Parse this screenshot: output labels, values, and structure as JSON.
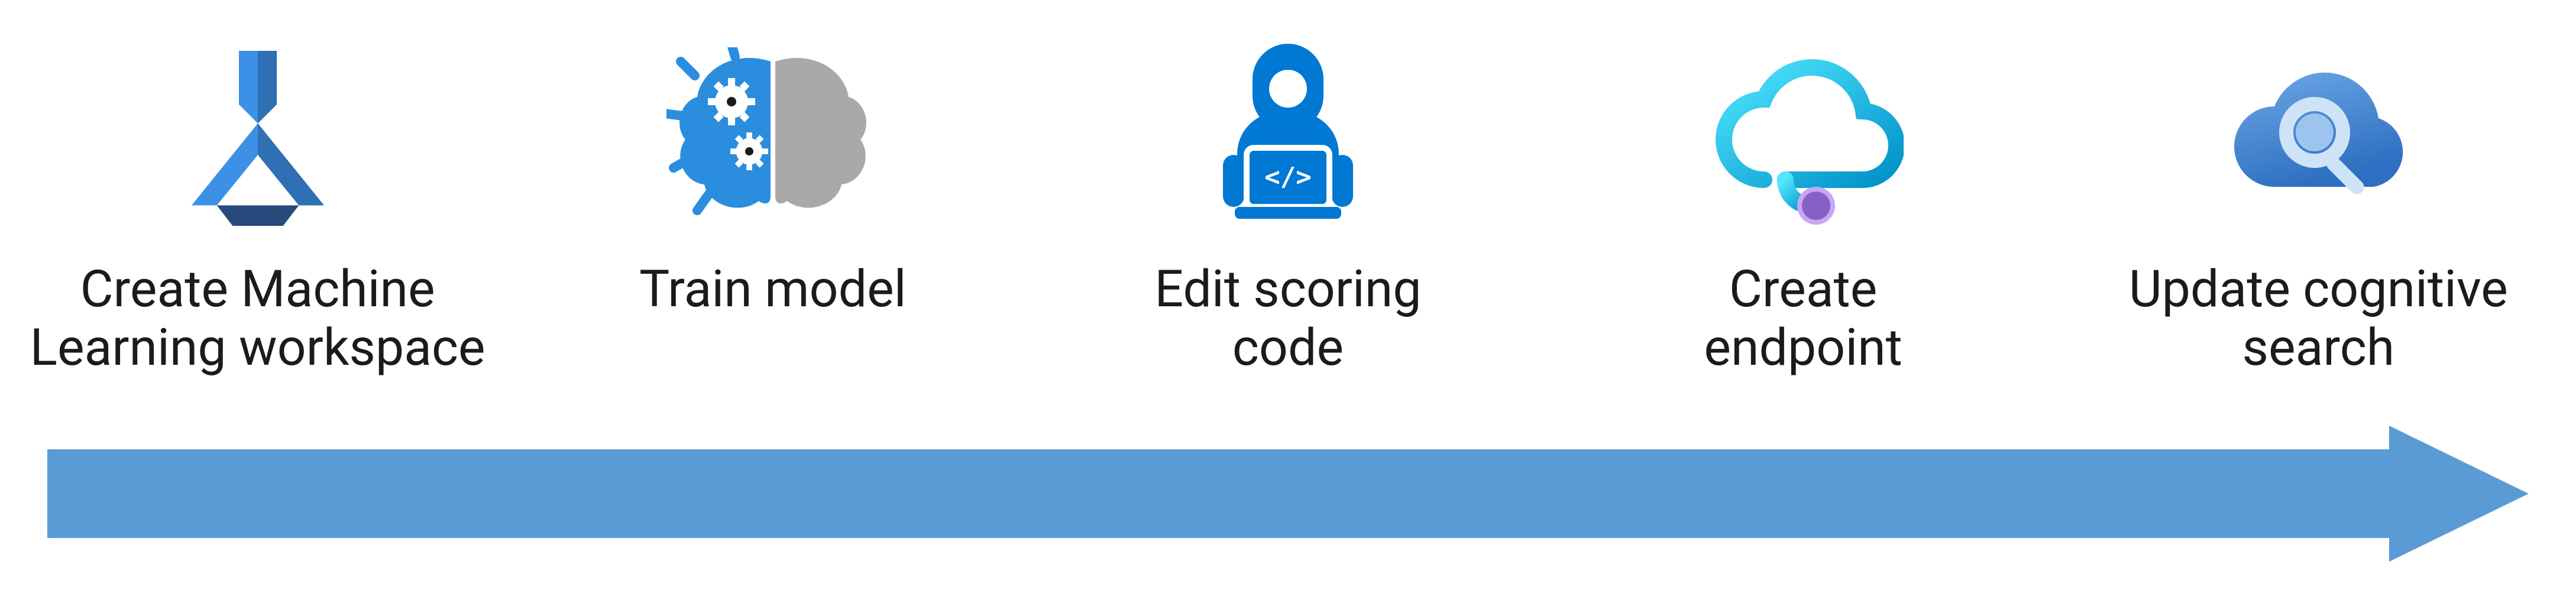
{
  "diagram": {
    "type": "process-arrow",
    "steps": [
      {
        "id": "ml-workspace",
        "label": "Create Machine\nLearning workspace",
        "icon": "azure-ml-flask-icon"
      },
      {
        "id": "train-model",
        "label": "Train model",
        "icon": "brain-gears-icon"
      },
      {
        "id": "edit-scoring",
        "label": "Edit scoring\ncode",
        "icon": "developer-laptop-icon"
      },
      {
        "id": "create-endpoint",
        "label": "Create\nendpoint",
        "icon": "cloud-endpoint-icon"
      },
      {
        "id": "update-search",
        "label": "Update cognitive\nsearch",
        "icon": "cloud-search-icon"
      }
    ],
    "colors": {
      "arrow": "#5B9BD5",
      "azure_blue": "#0078D4",
      "azure_dark": "#264A7C",
      "azure_light": "#50E6FF",
      "teal": "#00B6CB",
      "gray": "#A9A9A9",
      "purple": "#8661C5"
    }
  }
}
